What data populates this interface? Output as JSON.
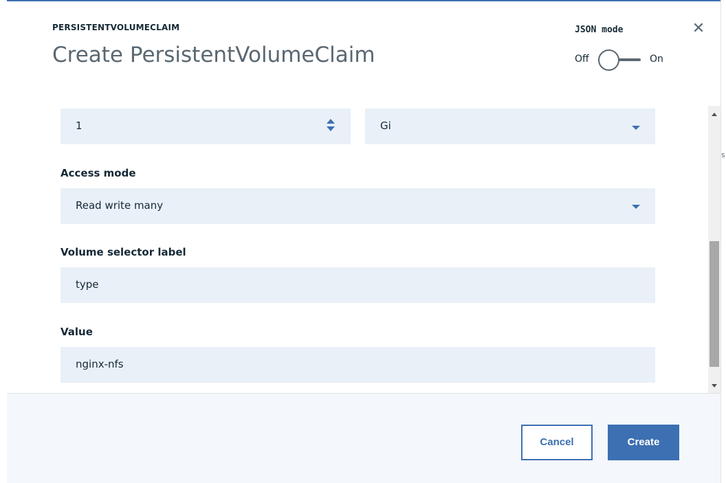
{
  "modal": {
    "eyebrow": "PERSISTENTVOLUMECLAIM",
    "title": "Create PersistentVolumeClaim",
    "close_icon": "close-icon"
  },
  "json_mode": {
    "label": "JSON mode",
    "off_label": "Off",
    "on_label": "On",
    "enabled": false
  },
  "form": {
    "storage_amount": "1",
    "storage_unit": "Gi",
    "access_mode": {
      "label": "Access mode",
      "value": "Read write many"
    },
    "volume_selector_label": {
      "label": "Volume selector label",
      "value": "type"
    },
    "value": {
      "label": "Value",
      "value": "nginx-nfs"
    }
  },
  "footer": {
    "cancel_label": "Cancel",
    "create_label": "Create"
  },
  "background": {
    "edge_char": "s"
  },
  "colors": {
    "accent": "#3d70b2",
    "field_bg": "#e9f0f7",
    "footer_bg": "#f4f7fb"
  }
}
